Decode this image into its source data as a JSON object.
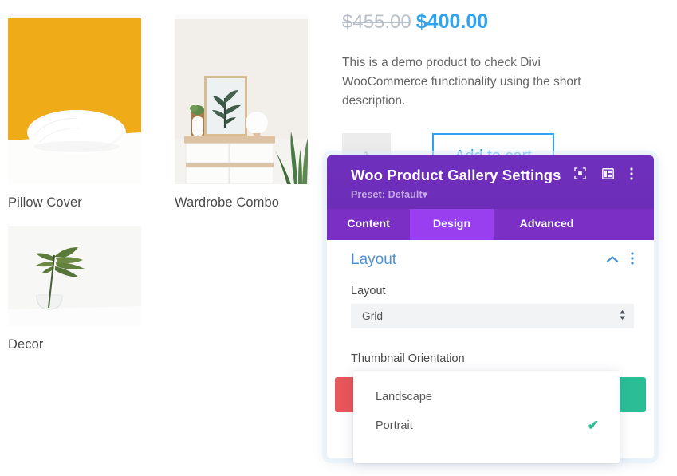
{
  "gallery": {
    "items": [
      {
        "label": "Pillow Cover",
        "image": "pillow-on-orange-background"
      },
      {
        "label": "Wardrobe Combo",
        "image": "dresser-with-framed-plant-art"
      },
      {
        "label": "Decor",
        "image": "monstera-leaf-in-glass-vase"
      }
    ]
  },
  "product": {
    "price_old": "$455.00",
    "price_new": "$400.00",
    "description": "This is a demo product to check Divi WooCommerce functionality using the short description.",
    "quantity": "1",
    "add_to_cart_label": "Add to cart"
  },
  "modal": {
    "title": "Woo Product Gallery Settings",
    "preset": "Preset: Default",
    "preset_caret": "▾",
    "header_icons": [
      {
        "name": "focus-icon"
      },
      {
        "name": "panel-layout-icon"
      },
      {
        "name": "more-options-icon"
      }
    ],
    "tabs": [
      {
        "label": "Content",
        "active": false
      },
      {
        "label": "Design",
        "active": true
      },
      {
        "label": "Advanced",
        "active": false
      }
    ],
    "section": {
      "title": "Layout",
      "collapse_icon": "chevron-up-icon",
      "menu_icon": "more-options-icon"
    },
    "fields": [
      {
        "label": "Layout",
        "value": "Grid",
        "type": "select"
      },
      {
        "label": "Thumbnail Orientation",
        "value": "Portrait",
        "type": "select"
      }
    ],
    "footer": {
      "cancel_label": "",
      "save_label": ""
    }
  },
  "dropdown": {
    "options": [
      {
        "label": "Landscape",
        "selected": false
      },
      {
        "label": "Portrait",
        "selected": true
      }
    ],
    "check_glyph": "✔"
  },
  "colors": {
    "accent_blue": "#2ea3f2",
    "header_purple": "#6c2eb9",
    "tab_active": "#9a3ff0",
    "save_green": "#2bbe96",
    "cancel_red": "#e8555a",
    "section_blue": "#5091cd"
  }
}
